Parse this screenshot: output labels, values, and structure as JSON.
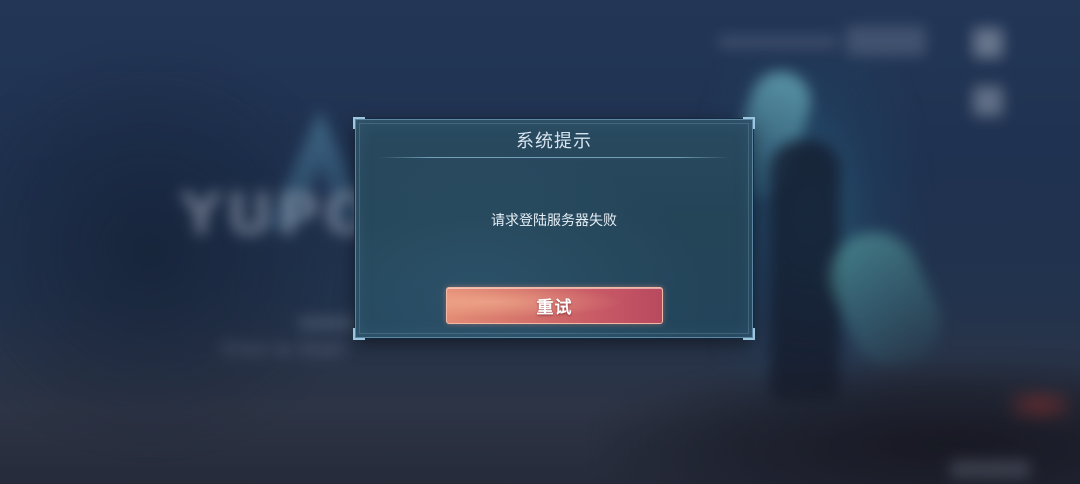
{
  "dialog": {
    "title": "系统提示",
    "message": "请求登陆服务器失败",
    "retry_label": "重试"
  },
  "background": {
    "logo_text": "YUPO",
    "click_hint": "Click to Start"
  },
  "colors": {
    "dialog_bg": "#244458",
    "dialog_border": "#5d86a2",
    "button_start": "#e38c76",
    "button_end": "#b8495f",
    "title_text": "#d6e3ef"
  }
}
